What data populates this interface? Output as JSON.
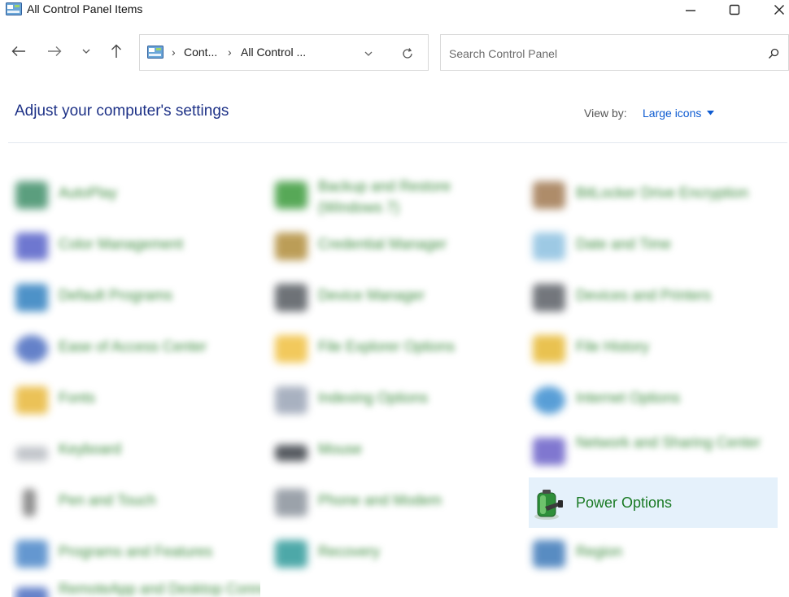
{
  "window": {
    "title": "All Control Panel Items"
  },
  "address_bar": {
    "crumbs": [
      "Cont...",
      "All Control ..."
    ]
  },
  "search": {
    "placeholder": "Search Control Panel"
  },
  "header": {
    "title": "Adjust your computer's settings",
    "view_by_label": "View by:",
    "view_by_value": "Large icons"
  },
  "items": {
    "autoplay": "AutoPlay",
    "backup_restore": "Backup and Restore (Windows 7)",
    "bitlocker": "BitLocker Drive Encryption",
    "color_mgmt": "Color Management",
    "credential_mgr": "Credential Manager",
    "date_time": "Date and Time",
    "default_programs": "Default Programs",
    "device_mgr": "Device Manager",
    "devices_printers": "Devices and Printers",
    "ease_access": "Ease of Access Center",
    "explorer_options": "File Explorer Options",
    "file_history": "File History",
    "fonts": "Fonts",
    "indexing": "Indexing Options",
    "internet_options": "Internet Options",
    "keyboard": "Keyboard",
    "mouse": "Mouse",
    "network_sharing": "Network and Sharing Center",
    "pen_touch": "Pen and Touch",
    "phone_modem": "Phone and Modem",
    "power_options": "Power Options",
    "programs_features": "Programs and Features",
    "recovery": "Recovery",
    "region": "Region",
    "remoteapp": "RemoteApp and Desktop Connections"
  },
  "colors": {
    "accent_link": "#0e5bd1",
    "title_blue": "#1e3287",
    "item_green": "#1a7a24",
    "selection_bg": "#e5f1fb"
  }
}
